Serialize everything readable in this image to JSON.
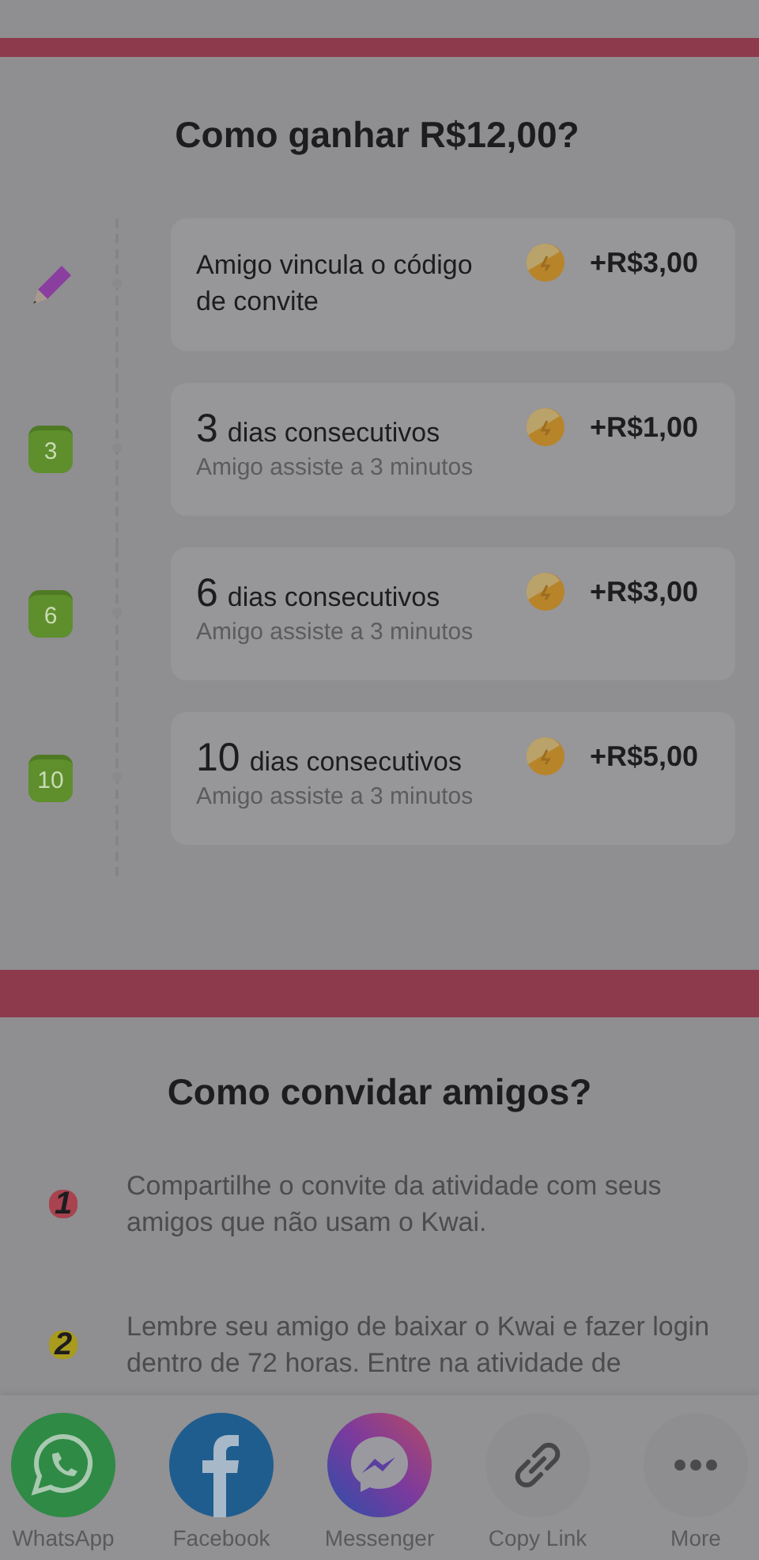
{
  "earn_section": {
    "title": "Como ganhar R$12,00?",
    "steps": [
      {
        "kind": "pencil",
        "title": "Amigo vincula o código de convite",
        "reward": "+R$3,00"
      },
      {
        "kind": "calendar",
        "calendar_number": "3",
        "count": "3",
        "title": "dias consecutivos",
        "subtitle": "Amigo assiste a 3 minutos",
        "reward": "+R$1,00"
      },
      {
        "kind": "calendar",
        "calendar_number": "6",
        "count": "6",
        "title": "dias consecutivos",
        "subtitle": "Amigo assiste a 3 minutos",
        "reward": "+R$3,00"
      },
      {
        "kind": "calendar",
        "calendar_number": "10",
        "count": "10",
        "title": "dias consecutivos",
        "subtitle": "Amigo assiste a 3 minutos",
        "reward": "+R$5,00"
      }
    ]
  },
  "invite_section": {
    "title": "Como convidar amigos?",
    "steps": [
      {
        "number": "1",
        "color": "#a8434f",
        "text": "Compartilhe o convite da atividade com seus amigos que não usam o Kwai."
      },
      {
        "number": "2",
        "color": "#a89b1e",
        "text": "Lembre seu amigo de baixar o Kwai e fazer login dentro de 72 horas. Entre na atividade de"
      }
    ]
  },
  "share_bar": [
    {
      "kind": "whatsapp",
      "label": "WhatsApp"
    },
    {
      "kind": "facebook",
      "label": "Facebook"
    },
    {
      "kind": "messenger",
      "label": "Messenger"
    },
    {
      "kind": "link",
      "label": "Copy Link"
    },
    {
      "kind": "more",
      "label": "More"
    }
  ]
}
